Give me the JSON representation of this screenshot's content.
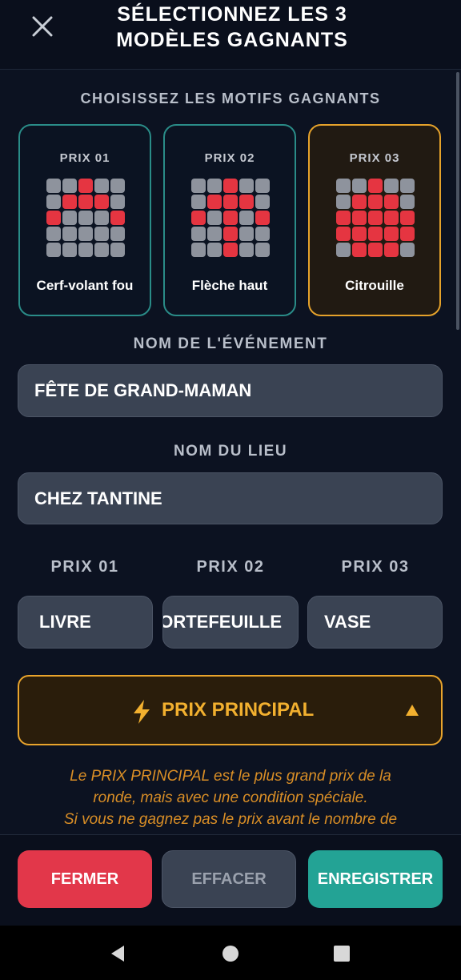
{
  "header": {
    "title_line1": "SÉLECTIONNEZ LES 3",
    "title_line2": "MODÈLES GAGNANTS",
    "close_icon": "close-icon"
  },
  "patterns": {
    "heading": "CHOISISSEZ LES MOTIFS GAGNANTS",
    "cards": [
      {
        "prize": "PRIX 01",
        "name": "Cerf-volant fou",
        "selected": false,
        "grid": [
          [
            0,
            0,
            1,
            0,
            0
          ],
          [
            0,
            1,
            1,
            1,
            0
          ],
          [
            1,
            0,
            0,
            0,
            1
          ],
          [
            0,
            0,
            0,
            0,
            0
          ],
          [
            0,
            0,
            0,
            0,
            0
          ]
        ]
      },
      {
        "prize": "PRIX 02",
        "name": "Flèche haut",
        "selected": false,
        "grid": [
          [
            0,
            0,
            1,
            0,
            0
          ],
          [
            0,
            1,
            1,
            1,
            0
          ],
          [
            1,
            0,
            1,
            0,
            1
          ],
          [
            0,
            0,
            1,
            0,
            0
          ],
          [
            0,
            0,
            1,
            0,
            0
          ]
        ]
      },
      {
        "prize": "PRIX 03",
        "name": "Citrouille",
        "selected": true,
        "grid": [
          [
            0,
            0,
            1,
            0,
            0
          ],
          [
            0,
            1,
            1,
            1,
            0
          ],
          [
            1,
            1,
            1,
            1,
            1
          ],
          [
            1,
            1,
            1,
            1,
            1
          ],
          [
            0,
            1,
            1,
            1,
            0
          ]
        ]
      }
    ]
  },
  "event": {
    "label": "NOM DE L'ÉVÉNEMENT",
    "value": "FÊTE DE GRAND-MAMAN"
  },
  "venue": {
    "label": "NOM DU LIEU",
    "value": "CHEZ TANTINE"
  },
  "prizes": [
    {
      "label": "PRIX 01",
      "value": "LIVRE"
    },
    {
      "label": "PRIX 02",
      "value": "PORTEFEUILLE"
    },
    {
      "label": "PRIX 03",
      "value": "VASE"
    }
  ],
  "grand_prize": {
    "label": "PRIX PRINCIPAL",
    "icon": "lightning-icon",
    "toggle_icon": "triangle-up-icon",
    "note_line1": "Le PRIX PRINCIPAL est le plus grand prix de la",
    "note_line2": "ronde, mais avec une condition spéciale.",
    "note_line3": "Si vous ne gagnez pas le prix avant le nombre de"
  },
  "buttons": {
    "close": "FERMER",
    "clear": "EFFACER",
    "save": "ENREGISTRER"
  },
  "colors": {
    "teal_border": "#2a8c88",
    "orange_accent": "#e9a42c",
    "red_cell": "#e53541",
    "gray_cell": "#8e939d",
    "red_button": "#e2374a",
    "teal_button": "#23a395",
    "dark_button": "#3a4353"
  }
}
